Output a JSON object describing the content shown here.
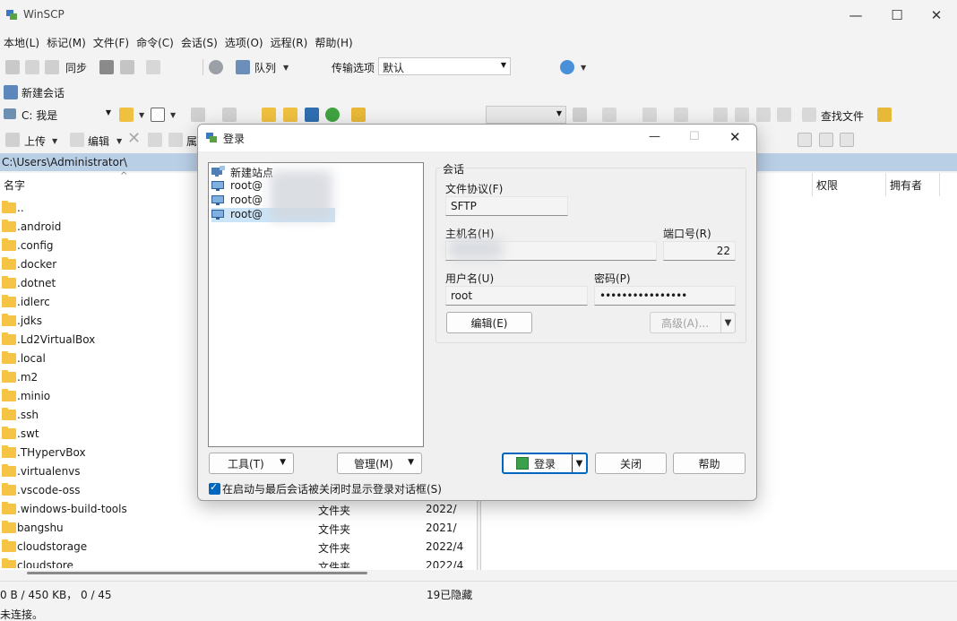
{
  "window": {
    "title": "WinSCP",
    "minimize": "—",
    "maximize": "☐",
    "close": "✕"
  },
  "menu": [
    "本地(L)",
    "标记(M)",
    "文件(F)",
    "命令(C)",
    "会话(S)",
    "选项(O)",
    "远程(R)",
    "帮助(H)"
  ],
  "toolbar1": {
    "sync_label": "同步",
    "queue_label": "队列",
    "transfer_label": "传输选项",
    "transfer_value": "默认"
  },
  "toolbar2": {
    "new_session_label": "新建会话"
  },
  "toolbar3": {
    "drive_value": "C: 我是",
    "find_files_label": "查找文件"
  },
  "toolbar4": {
    "upload_label": "上传",
    "edit_label": "编辑",
    "props_label": "属"
  },
  "local": {
    "path": "C:\\Users\\Administrator\\",
    "col_name": "名字",
    "files": [
      {
        "name": "..",
        "type": "",
        "date": ""
      },
      {
        "name": ".android",
        "type": "",
        "date": ""
      },
      {
        "name": ".config",
        "type": "",
        "date": ""
      },
      {
        "name": ".docker",
        "type": "",
        "date": ""
      },
      {
        "name": ".dotnet",
        "type": "",
        "date": ""
      },
      {
        "name": ".idlerc",
        "type": "",
        "date": ""
      },
      {
        "name": ".jdks",
        "type": "",
        "date": ""
      },
      {
        "name": ".Ld2VirtualBox",
        "type": "",
        "date": ""
      },
      {
        "name": ".local",
        "type": "",
        "date": ""
      },
      {
        "name": ".m2",
        "type": "",
        "date": ""
      },
      {
        "name": ".minio",
        "type": "",
        "date": ""
      },
      {
        "name": ".ssh",
        "type": "",
        "date": ""
      },
      {
        "name": ".swt",
        "type": "",
        "date": ""
      },
      {
        "name": ".THypervBox",
        "type": "",
        "date": ""
      },
      {
        "name": ".virtualenvs",
        "type": "",
        "date": ""
      },
      {
        "name": ".vscode-oss",
        "type": "",
        "date": ""
      },
      {
        "name": ".windows-build-tools",
        "type": "",
        "date": ""
      },
      {
        "name": "bangshu",
        "type": "文件夹",
        "date": "2021/"
      },
      {
        "name": "cloudstorage",
        "type": "文件夹",
        "date": "2022/4"
      },
      {
        "name": "cloudstore",
        "type": "文件夹",
        "date": "2022/4"
      }
    ],
    "first_visible_type": "文件夹",
    "first_visible_date": "2022/"
  },
  "remote": {
    "col_perm": "权限",
    "col_owner": "拥有者"
  },
  "status": {
    "left": "0 B / 450 KB，  0 / 45",
    "hidden": "19已隐藏",
    "connection": "未连接。"
  },
  "dialog": {
    "title": "登录",
    "minimize": "—",
    "maximize": "☐",
    "close": "✕",
    "sites": [
      {
        "label": "新建站点"
      },
      {
        "label": "root@"
      },
      {
        "label": "root@"
      },
      {
        "label": "root@"
      }
    ],
    "session_group": "会话",
    "protocol_label": "文件协议(F)",
    "protocol_value": "SFTP",
    "host_label": "主机名(H)",
    "host_value": "",
    "port_label": "端口号(R)",
    "port_value": "22",
    "user_label": "用户名(U)",
    "user_value": "root",
    "password_label": "密码(P)",
    "password_value": "••••••••••••••••",
    "edit_button": "编辑(E)",
    "advanced_button": "高级(A)...",
    "tools_button": "工具(T)",
    "manage_button": "管理(M)",
    "login_button": "登录",
    "close_button": "关闭",
    "help_button": "帮助",
    "checkbox_label": "在启动与最后会话被关闭时显示登录对话框(S)",
    "checkbox_checked": true
  },
  "colors": {
    "accent": "#0067c0",
    "path_bar": "#b9cfe6",
    "folder": "#f6c445"
  }
}
